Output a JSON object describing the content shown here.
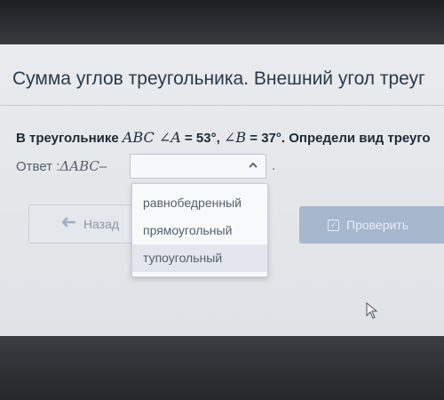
{
  "page": {
    "title": "Сумма углов треугольника. Внешний угол треуг"
  },
  "question": {
    "prefix": "В треугольнике ",
    "triangle": "ABC",
    "angle_a_name": "A",
    "angle_a_value": " = 53°, ",
    "angle_b_name": "B",
    "angle_b_value": " = 37°. Определи вид треуго"
  },
  "answer": {
    "label": "Ответ : ",
    "delta": "Δ",
    "triangle": "ABC",
    "dash": " –",
    "selected": "",
    "period": "."
  },
  "dropdown": {
    "options": [
      "равнобедренный",
      "прямоугольный",
      "тупоугольный"
    ],
    "highlighted_index": 2
  },
  "buttons": {
    "back_label": "Назад",
    "check_label": "Проверить"
  },
  "colors": {
    "check_button": "#a7b7cd",
    "back_arrow": "#9fb0c6",
    "title_text": "#2a3b4d"
  },
  "icons": {
    "back": "arrow-left-icon",
    "check": "checkbox-icon",
    "select": "chevron-up-icon"
  }
}
